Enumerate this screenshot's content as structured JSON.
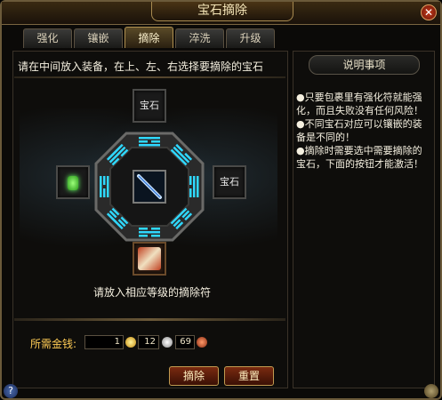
{
  "window": {
    "title": "宝石摘除"
  },
  "tabs": [
    {
      "label": "强化"
    },
    {
      "label": "镶嵌"
    },
    {
      "label": "摘除"
    },
    {
      "label": "淬洗"
    },
    {
      "label": "升级"
    }
  ],
  "main": {
    "instruction": "请在中间放入装备，在上、左、右选择要摘除的宝石",
    "slot_top_label": "宝石",
    "slot_right_label": "宝石",
    "hint": "请放入相应等级的摘除符"
  },
  "cost": {
    "label": "所需金钱:",
    "gold": "1",
    "silver": "12",
    "copper": "69"
  },
  "buttons": {
    "remove": "摘除",
    "reset": "重置"
  },
  "notes": {
    "title": "说明事项",
    "items": [
      "●只要包裹里有强化符就能强化，而且失败没有任何风险！",
      "●不同宝石对应可以镶嵌的装备是不同的！",
      "●摘除时需要选中需要摘除的宝石，下面的按钮才能激活！"
    ]
  },
  "colors": {
    "bagua_glow": "#2fd8ff",
    "accent_gold": "#ffcc55",
    "button_red": "#7a2a10"
  }
}
